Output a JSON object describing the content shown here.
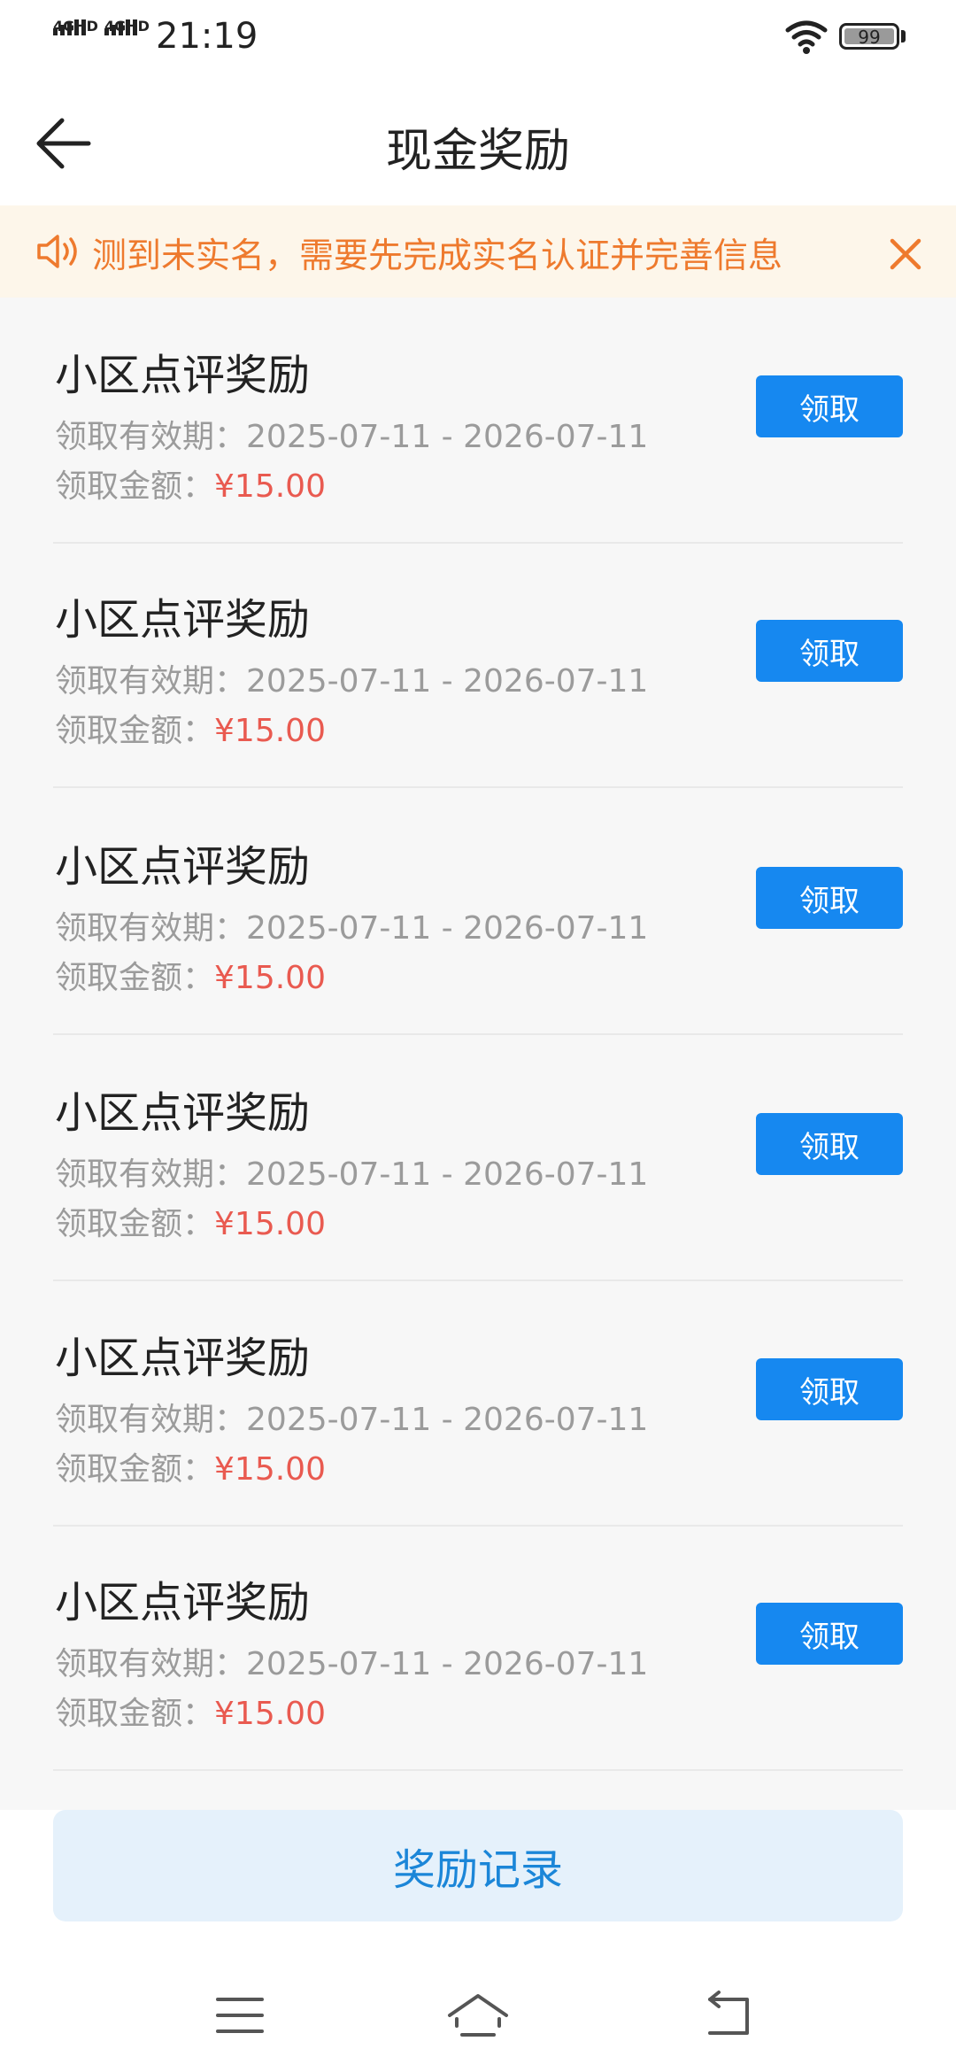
{
  "status_bar": {
    "network_1": "4GHD",
    "network_2": "4GHD",
    "time": "21:19",
    "battery": "99",
    "icons": [
      "signal-icon",
      "signal-icon",
      "wifi-icon",
      "battery-icon"
    ]
  },
  "header": {
    "title": "现金奖励",
    "back_icon": "arrow-left-icon"
  },
  "notice": {
    "icon": "speaker-icon",
    "text": "测到未实名，需要先完成实名认证并完善信息",
    "close_icon": "close-icon"
  },
  "rewards": [
    {
      "name": "小区点评奖励",
      "period_label": "领取有效期：",
      "period": "2025-07-11 - 2026-07-11",
      "amount_label": "领取金额：",
      "amount": "¥15.00",
      "button": "领取"
    },
    {
      "name": "小区点评奖励",
      "period_label": "领取有效期：",
      "period": "2025-07-11 - 2026-07-11",
      "amount_label": "领取金额：",
      "amount": "¥15.00",
      "button": "领取"
    },
    {
      "name": "小区点评奖励",
      "period_label": "领取有效期：",
      "period": "2025-07-11 - 2026-07-11",
      "amount_label": "领取金额：",
      "amount": "¥15.00",
      "button": "领取"
    },
    {
      "name": "小区点评奖励",
      "period_label": "领取有效期：",
      "period": "2025-07-11 - 2026-07-11",
      "amount_label": "领取金额：",
      "amount": "¥15.00",
      "button": "领取"
    },
    {
      "name": "小区点评奖励",
      "period_label": "领取有效期：",
      "period": "2025-07-11 - 2026-07-11",
      "amount_label": "领取金额：",
      "amount": "¥15.00",
      "button": "领取"
    },
    {
      "name": "小区点评奖励",
      "period_label": "领取有效期：",
      "period": "2025-07-11 - 2026-07-11",
      "amount_label": "领取金额：",
      "amount": "¥15.00",
      "button": "领取"
    }
  ],
  "footer": {
    "record_button": "奖励记录"
  },
  "nav": {
    "icons": [
      "menu-icon",
      "home-icon",
      "back-nav-icon"
    ]
  },
  "colors": {
    "accent": "#1688f0",
    "amount": "#e95a50",
    "notice_text": "#ee7a2e",
    "notice_bg": "#fdf6ea",
    "record_bg": "#e5f1fb",
    "record_text": "#1b86d8"
  }
}
